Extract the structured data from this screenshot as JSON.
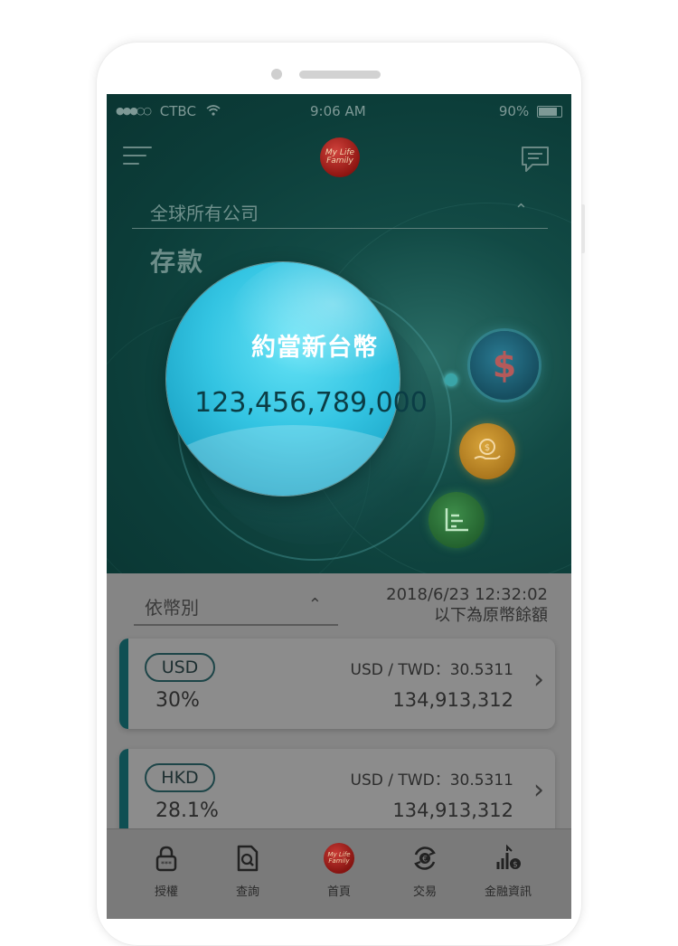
{
  "status_bar": {
    "carrier": "CTBC",
    "time": "9:06 AM",
    "battery": "90%"
  },
  "header": {
    "logo_text": "My Life Family"
  },
  "company_selector": {
    "value": "全球所有公司"
  },
  "section_title": "存款",
  "summary": {
    "title": "約當新台幣",
    "amount": "123,456,789,000"
  },
  "side_icons": [
    "dollar-icon",
    "coin-hand-icon",
    "chart-icon"
  ],
  "currency_filter": {
    "value": "依幣別"
  },
  "timestamp": {
    "datetime": "2018/6/23 12:32:02",
    "note": "以下為原幣餘額"
  },
  "accounts": [
    {
      "code": "USD",
      "percent": "30%",
      "rate": "USD / TWD：30.5311",
      "amount": "134,913,312"
    },
    {
      "code": "HKD",
      "percent": "28.1%",
      "rate": "USD / TWD：30.5311",
      "amount": "134,913,312"
    }
  ],
  "bottom_nav": [
    {
      "label": "授權",
      "icon": "lock-icon"
    },
    {
      "label": "查詢",
      "icon": "search-document-icon"
    },
    {
      "label": "首頁",
      "icon": "home-logo-icon"
    },
    {
      "label": "交易",
      "icon": "exchange-icon"
    },
    {
      "label": "金融資訊",
      "icon": "finance-chart-icon"
    }
  ],
  "colors": {
    "hero_bg": "#0c3d39",
    "bubble": "#33c4e2",
    "card_accent": "#0f4f53",
    "overlay_gray": "#858585"
  }
}
